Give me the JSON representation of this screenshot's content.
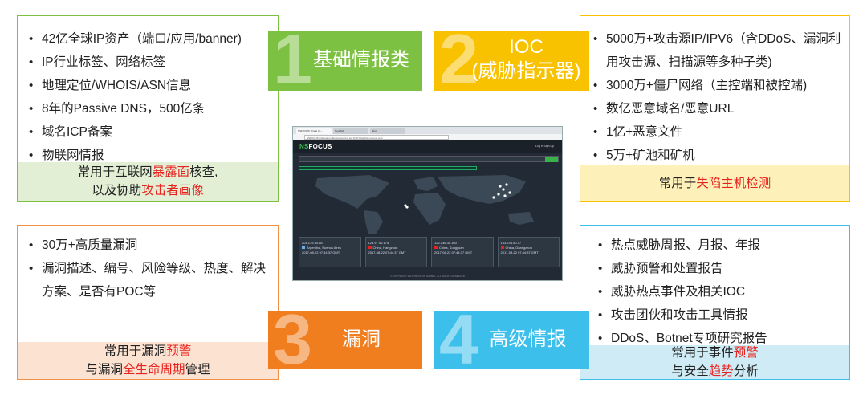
{
  "sections": [
    {
      "num": "1",
      "title_lines": [
        "基础情报类"
      ],
      "items": [
        "42亿全球IP资产（端口/应用/banner)",
        "IP行业标签、网络标签",
        "地理定位/WHOIS/ASN信息",
        "8年的Passive DNS，500亿条",
        "域名ICP备案",
        "物联网情报"
      ],
      "summary": [
        [
          {
            "t": "常用于互联网",
            "hl": false
          },
          {
            "t": "暴露面",
            "hl": true
          },
          {
            "t": "核查,",
            "hl": false
          }
        ],
        [
          {
            "t": "以及协助",
            "hl": false
          },
          {
            "t": "攻击者画像",
            "hl": true
          }
        ]
      ]
    },
    {
      "num": "2",
      "title_lines": [
        "IOC",
        "(威胁指示器)"
      ],
      "items": [
        "5000万+攻击源IP/IPV6（含DDoS、漏洞利用攻击源、扫描源等多种子类)",
        "3000万+僵尸网络（主控端和被控端)",
        "数亿恶意域名/恶意URL",
        "1亿+恶意文件",
        "5万+矿池和矿机"
      ],
      "summary": [
        [
          {
            "t": "常用于",
            "hl": false
          },
          {
            "t": "失陷主机检测",
            "hl": true
          }
        ]
      ]
    },
    {
      "num": "3",
      "title_lines": [
        "漏洞"
      ],
      "items": [
        "30万+高质量漏洞",
        "漏洞描述、编号、风险等级、热度、解决方案、是否有POC等"
      ],
      "summary": [
        [
          {
            "t": "常用于漏洞",
            "hl": false
          },
          {
            "t": "预警",
            "hl": true
          }
        ],
        [
          {
            "t": "与漏洞",
            "hl": false
          },
          {
            "t": "全生命周期",
            "hl": true
          },
          {
            "t": "管理",
            "hl": false
          }
        ]
      ]
    },
    {
      "num": "4",
      "title_lines": [
        "高级情报"
      ],
      "items": [
        "热点威胁周报、月报、年报",
        "威胁预警和处置报告",
        "威胁热点事件及相关IOC",
        "攻击团伙和攻击工具情报",
        "DDoS、Botnet专项研究报告"
      ],
      "summary": [
        [
          {
            "t": "常用于事件",
            "hl": false
          },
          {
            "t": "预警",
            "hl": true
          }
        ],
        [
          {
            "t": "与安全",
            "hl": false
          },
          {
            "t": "趋势",
            "hl": true
          },
          {
            "t": "分析",
            "hl": false
          }
        ]
      ]
    }
  ],
  "screenshot": {
    "tabs": [
      "NSFOCUS Threat Int...",
      "New Tab",
      "Bing"
    ],
    "url": "NSFOCUS Information Technology Co.,Ltd.[CN]  https://nti.nsfocus.com",
    "logo_a": "NS",
    "logo_b": "FOCUS",
    "nav_right": "Log in   Sign Up",
    "search_placeholder": "Search for IP, Domain, Vulnerability or Hash(MD5,SHA256)",
    "ticker": "Threat Intel Report Update",
    "ips": [
      {
        "ip": "201.179.34.88",
        "loc": "Argentina, Buenos Aires",
        "time": "2017-08-22 07:44:37 GMT"
      },
      {
        "ip": "123.97.40.175",
        "loc": "China, Hangzhou",
        "time": "2017-08-22 07:44:37 GMT"
      },
      {
        "ip": "122.136.35.160",
        "loc": "China, Songyuan",
        "time": "2017-08-22 07:44:37 GMT"
      },
      {
        "ip": "183.238.50.47",
        "loc": "China, Guangzhou",
        "time": "2017-08-22 07:44:37 GMT"
      }
    ],
    "footer": "© COPYRIGHT 2017 NSFOCUS GLOBAL, ALL RIGHTS RESERVED",
    "colors": {
      "nav": "#1b2128",
      "map_bg": "#222b35",
      "land": "#3b4856",
      "accent": "#35c24a",
      "hot": "#ffffff"
    }
  },
  "colors": {
    "green": "#7dc143",
    "yellow": "#f8c200",
    "orange": "#f07d1e",
    "blue": "#3cbfeb",
    "highlight": "#e8231f"
  }
}
